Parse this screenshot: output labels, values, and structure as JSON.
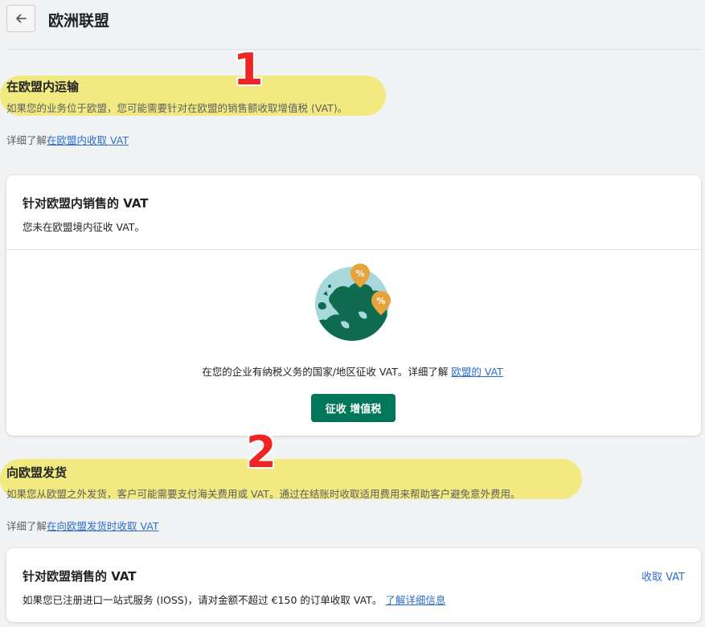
{
  "header": {
    "back_label": "←",
    "title": "欧洲联盟"
  },
  "annotations": {
    "marker1": "1",
    "marker2": "2"
  },
  "section_within_eu": {
    "title": "在欧盟内运输",
    "description": "如果您的业务位于欧盟，您可能需要针对在欧盟的销售额收取增值税 (VAT)。",
    "learn_prefix": "详细了解",
    "learn_link": "在欧盟内收取 VAT"
  },
  "card_within_eu": {
    "title": "针对欧盟内销售的 VAT",
    "subtitle": "您未在欧盟境内征收 VAT。",
    "empty_text": "在您的企业有纳税义务的国家/地区征收 VAT。详细了解 ",
    "empty_link": "欧盟的 VAT",
    "button_label": "征收 增值税",
    "illustration_icon": "europe-globe-with-percent-pins-icon"
  },
  "section_to_eu": {
    "title": "向欧盟发货",
    "description": "如果您从欧盟之外发货，客户可能需要支付海关费用或 VAT。通过在结账时收取适用费用来帮助客户避免意外费用。",
    "learn_prefix": "详细了解",
    "learn_link": "在向欧盟发货时收取 VAT"
  },
  "card_to_eu": {
    "title": "针对欧盟销售的 VAT",
    "action_link": "收取 VAT",
    "description": "如果您已注册进口一站式服务 (IOSS)，请对金额不超过 €150 的订单收取 VAT。",
    "description_link": "了解详细信息"
  },
  "colors": {
    "primary": "#00775a",
    "link": "#2c6ecb",
    "highlight": "#f1e97a",
    "marker": "#ef2525",
    "pin": "#e8a33d"
  }
}
